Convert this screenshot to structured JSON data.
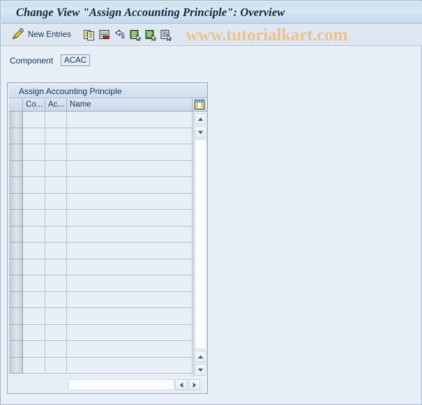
{
  "window": {
    "title": "Change View \"Assign Accounting Principle\": Overview"
  },
  "toolbar": {
    "display_change_icon": "pencil-toggle-icon",
    "new_entries_label": "New Entries",
    "buttons": [
      {
        "name": "copy-as-icon",
        "title": "Copy As..."
      },
      {
        "name": "delete-row-icon",
        "title": "Delete"
      },
      {
        "name": "undo-icon",
        "title": "Undo Change"
      },
      {
        "name": "select-all-icon",
        "title": "Select All"
      },
      {
        "name": "deselect-all-icon",
        "title": "Deselect All"
      },
      {
        "name": "details-icon",
        "title": "Details"
      }
    ]
  },
  "watermark": {
    "text": "www.tutorialkart.com",
    "color": "#eec091"
  },
  "component": {
    "label": "Component",
    "value": "ACAC"
  },
  "table": {
    "caption": "Assign Accounting Principle",
    "config_icon": "table-settings-icon",
    "columns": [
      {
        "key": "selector",
        "label": ""
      },
      {
        "key": "co",
        "label": "Co..."
      },
      {
        "key": "ac",
        "label": "Ac..."
      },
      {
        "key": "name",
        "label": "Name"
      }
    ],
    "rows": [],
    "empty_row_count": 16,
    "vertical_scrollbar": {
      "up_arrow": "scroll-up-icon",
      "down_arrow": "scroll-down-icon",
      "page_up_arrow": "scroll-up-icon",
      "page_down_arrow": "scroll-down-icon"
    },
    "horizontal_scrollbar": {
      "left_arrow": "scroll-left-icon",
      "right_arrow": "scroll-right-icon"
    }
  },
  "colors": {
    "window_background": "#e8eef5",
    "title_bar": "#d2e0f0",
    "frame_border": "#8aa7c2",
    "text": "#16325b"
  }
}
